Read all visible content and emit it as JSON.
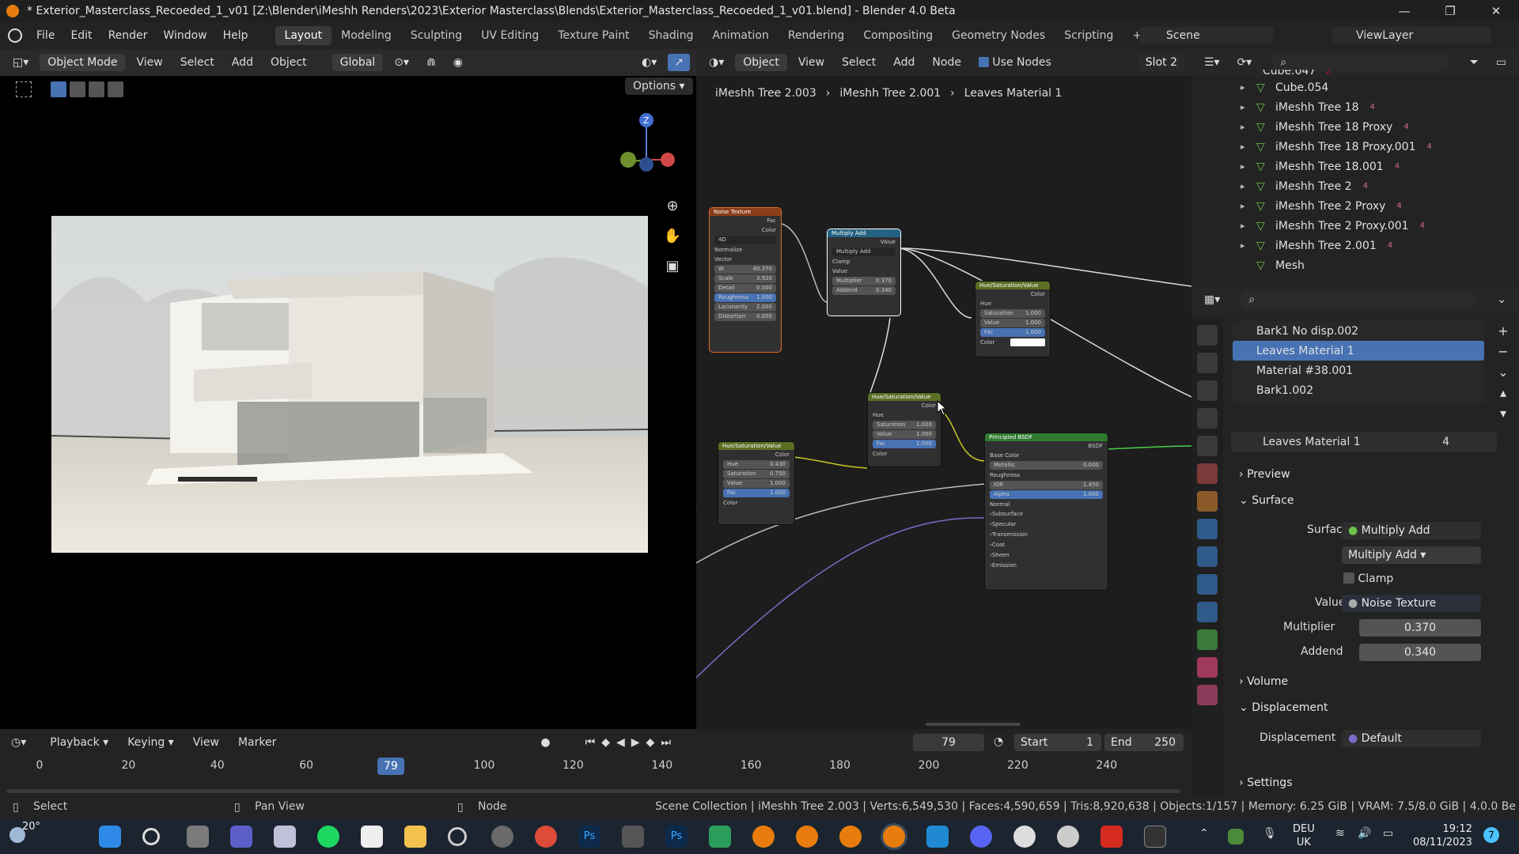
{
  "titlebar": {
    "title": "* Exterior_Masterclass_Recoeded_1_v01 [Z:\\Blender\\iMeshh Renders\\2023\\Exterior Masterclass\\Blends\\Exterior_Masterclass_Recoeded_1_v01.blend] - Blender 4.0 Beta"
  },
  "menu": {
    "items": [
      "File",
      "Edit",
      "Render",
      "Window",
      "Help"
    ],
    "workspaces": [
      "Layout",
      "Modeling",
      "Sculpting",
      "UV Editing",
      "Texture Paint",
      "Shading",
      "Animation",
      "Rendering",
      "Compositing",
      "Geometry Nodes",
      "Scripting"
    ],
    "active_workspace": "Layout",
    "scene": "Scene",
    "view_layer": "ViewLayer"
  },
  "viewport": {
    "mode": "Object Mode",
    "menus": [
      "View",
      "Select",
      "Add",
      "Object"
    ],
    "transform": "Global",
    "options": "Options",
    "gizmo_z": "Z"
  },
  "node_editor": {
    "type": "Object",
    "menus": [
      "View",
      "Select",
      "Add",
      "Node"
    ],
    "use_nodes": "Use Nodes",
    "slot": "Slot 2",
    "breadcrumb": [
      "iMeshh Tree 2.003",
      "iMeshh Tree 2.001",
      "Leaves Material 1"
    ],
    "nodes": {
      "noise": {
        "title": "Noise Texture",
        "outs": [
          "Fac",
          "Color"
        ],
        "dim": "4D",
        "normalize": "Normalize",
        "vector": "Vector",
        "rows": [
          [
            "W",
            "40.370"
          ],
          [
            "Scale",
            "3.920"
          ],
          [
            "Detail",
            "0.000"
          ],
          [
            "Roughness",
            "1.000"
          ],
          [
            "Lacunarity",
            "2.000"
          ],
          [
            "Distortion",
            "0.000"
          ]
        ]
      },
      "multiply": {
        "title": "Multiply Add",
        "out": "Value",
        "op": "Multiply Add",
        "clamp": "Clamp",
        "value": "Value",
        "rows": [
          [
            "Multiplier",
            "0.370"
          ],
          [
            "Addend",
            "0.340"
          ]
        ]
      },
      "hsv1": {
        "title": "Hue/Saturation/Value",
        "out": "Color",
        "hue": "Hue",
        "rows": [
          [
            "Saturation",
            "1.000"
          ],
          [
            "Value",
            "1.000"
          ],
          [
            "Fac",
            "1.000"
          ]
        ],
        "color": "Color"
      },
      "hsv2": {
        "title": "Hue/Saturation/Value",
        "out": "Color",
        "hue": "Hue",
        "rows": [
          [
            "Saturation",
            "1.000"
          ],
          [
            "Value",
            "1.000"
          ],
          [
            "Fac",
            "1.000"
          ]
        ],
        "color": "Color"
      },
      "hsv3": {
        "title": "Hue/Saturation/Value",
        "out": "Color",
        "rows": [
          [
            "Hue",
            "0.430"
          ],
          [
            "Saturation",
            "0.750"
          ],
          [
            "Value",
            "1.000"
          ],
          [
            "Fac",
            "1.000"
          ]
        ],
        "color": "Color"
      },
      "bsdf": {
        "title": "Principled BSDF",
        "out": "BSDF",
        "base": "Base Color",
        "roughness": "Roughness",
        "normal": "Normal",
        "rows": [
          [
            "Metallic",
            "0.000"
          ],
          [
            "IOR",
            "1.450"
          ],
          [
            "Alpha",
            "1.000"
          ]
        ],
        "subs": [
          "Subsurface",
          "Specular",
          "Transmission",
          "Coat",
          "Sheen",
          "Emission"
        ]
      }
    }
  },
  "outliner": {
    "items": [
      "Cube.054",
      "iMeshh Tree 18",
      "iMeshh Tree 18 Proxy",
      "iMeshh Tree 18 Proxy.001",
      "iMeshh Tree 18.001",
      "iMeshh Tree 2",
      "iMeshh Tree 2 Proxy",
      "iMeshh Tree 2 Proxy.001",
      "iMeshh Tree 2.001",
      "Mesh"
    ],
    "badges": [
      "",
      "4",
      "4",
      "4",
      "4",
      "4",
      "4",
      "4",
      "4",
      ""
    ],
    "partial_top": "Cube.047",
    "partial_badge": "2"
  },
  "properties": {
    "materials": [
      "Bark1 No disp.002",
      "Leaves Material 1",
      "Material #38.001",
      "Bark1.002"
    ],
    "active_material": "Leaves Material 1",
    "material_users": "4",
    "sections": {
      "preview": "Preview",
      "surface": "Surface",
      "volume": "Volume",
      "displacement": "Displacement",
      "settings": "Settings"
    },
    "surface_label": "Surface",
    "surface_value": "Multiply Add",
    "op_value": "Multiply Add",
    "clamp": "Clamp",
    "value_label": "Value",
    "value_value": "Noise Texture",
    "multiplier_label": "Multiplier",
    "multiplier_value": "0.370",
    "addend_label": "Addend",
    "addend_value": "0.340",
    "displacement_label": "Displacement",
    "displacement_value": "Default"
  },
  "timeline": {
    "menus": [
      "Playback",
      "Keying",
      "View",
      "Marker"
    ],
    "current_frame": "79",
    "start_label": "Start",
    "start": "1",
    "end_label": "End",
    "end": "250",
    "ticks": [
      "0",
      "20",
      "40",
      "60",
      "100",
      "120",
      "140",
      "160",
      "180",
      "200",
      "220",
      "240"
    ]
  },
  "status": {
    "select": "Select",
    "pan": "Pan View",
    "node": "Node",
    "info": "Scene Collection | iMeshh Tree 2.003 | Verts:6,549,530 | Faces:4,590,659 | Tris:8,920,638 | Objects:1/157 | Memory: 6.25 GiB | VRAM: 7.5/8.0 GiB | 4.0.0 Be"
  },
  "taskbar": {
    "weather": "20°",
    "lang": "DEU",
    "region": "UK",
    "time": "19:12",
    "date": "08/11/2023",
    "notif": "7"
  },
  "colors": {
    "accent": "#4772b3",
    "selection": "#4772b3",
    "node_texture": "#e26a2d",
    "node_converter": "#3a7ba8",
    "node_color": "#6f8f2c",
    "node_shader": "#3d8f3d",
    "timeline_frame": "#4772b3"
  }
}
